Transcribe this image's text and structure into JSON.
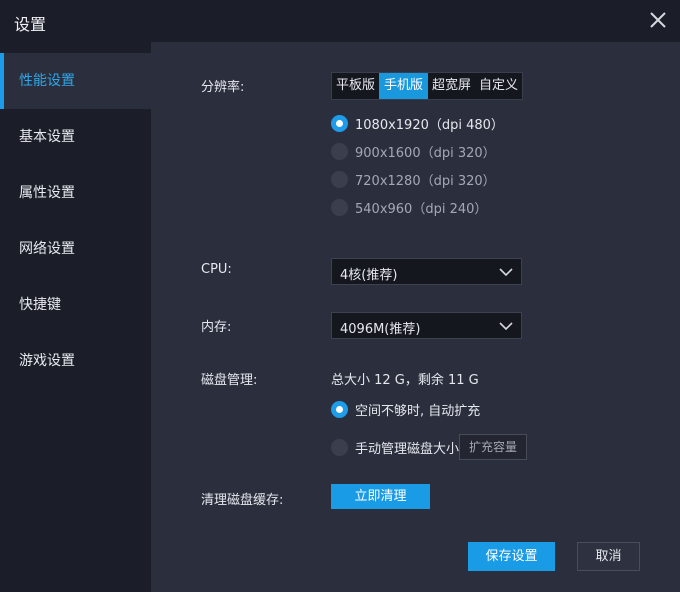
{
  "window": {
    "title": "设置",
    "close_icon": "close-icon"
  },
  "sidebar": {
    "items": [
      {
        "label": "性能设置",
        "active": true
      },
      {
        "label": "基本设置",
        "active": false
      },
      {
        "label": "属性设置",
        "active": false
      },
      {
        "label": "网络设置",
        "active": false
      },
      {
        "label": "快捷键",
        "active": false
      },
      {
        "label": "游戏设置",
        "active": false
      }
    ]
  },
  "resolution": {
    "label": "分辨率:",
    "tabs": [
      {
        "label": "平板版",
        "active": false
      },
      {
        "label": "手机版",
        "active": true
      },
      {
        "label": "超宽屏",
        "active": false
      },
      {
        "label": "自定义",
        "active": false
      }
    ],
    "options": [
      {
        "label": "1080x1920（dpi 480）",
        "selected": true
      },
      {
        "label": "900x1600（dpi 320）",
        "selected": false
      },
      {
        "label": "720x1280（dpi 320）",
        "selected": false
      },
      {
        "label": "540x960（dpi 240）",
        "selected": false
      }
    ]
  },
  "cpu": {
    "label": "CPU:",
    "value": "4核(推荐)"
  },
  "memory": {
    "label": "内存:",
    "value": "4096M(推荐)"
  },
  "disk": {
    "label": "磁盘管理:",
    "summary": "总大小 12 G，剩余 11 G",
    "auto_option": "空间不够时, 自动扩充",
    "manual_option": "手动管理磁盘大小",
    "expand_button": "扩充容量"
  },
  "cache": {
    "label": "清理磁盘缓存:",
    "button": "立即清理"
  },
  "footer": {
    "save": "保存设置",
    "cancel": "取消"
  },
  "colors": {
    "accent": "#1a9be5",
    "panel": "#2b2f3d",
    "background": "#1b1e29"
  }
}
